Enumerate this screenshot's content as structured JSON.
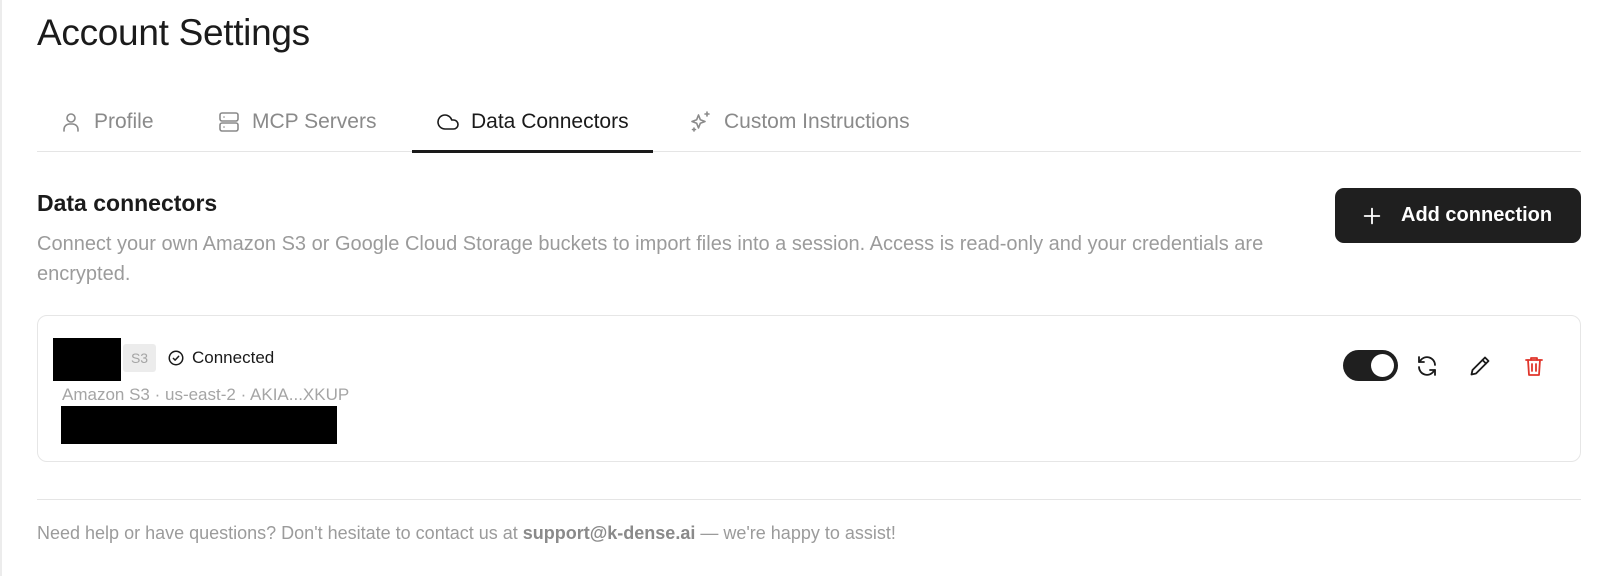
{
  "page": {
    "title": "Account Settings"
  },
  "tabs": [
    {
      "label": "Profile",
      "icon": "user-icon",
      "active": false
    },
    {
      "label": "MCP Servers",
      "icon": "server-icon",
      "active": false
    },
    {
      "label": "Data Connectors",
      "icon": "cloud-icon",
      "active": true
    },
    {
      "label": "Custom Instructions",
      "icon": "sparkles-icon",
      "active": false
    }
  ],
  "section": {
    "title": "Data connectors",
    "description": "Connect your own Amazon S3 or Google Cloud Storage buckets to import files into a session. Access is read-only and your credentials are encrypted.",
    "add_button_label": "Add connection"
  },
  "connections": [
    {
      "type_badge": "S3",
      "status": "Connected",
      "meta": "Amazon S3 · us-east-2 · AKIA...XKUP",
      "enabled": true
    }
  ],
  "footer": {
    "prefix": "Need help or have questions? Don't hesitate to contact us at ",
    "email": "support@k-dense.ai",
    "suffix": " — we're happy to assist!"
  },
  "colors": {
    "primary": "#1f1f1f",
    "muted_text": "#9b9b9b",
    "danger": "#e0352b",
    "border": "#e6e6e6"
  }
}
